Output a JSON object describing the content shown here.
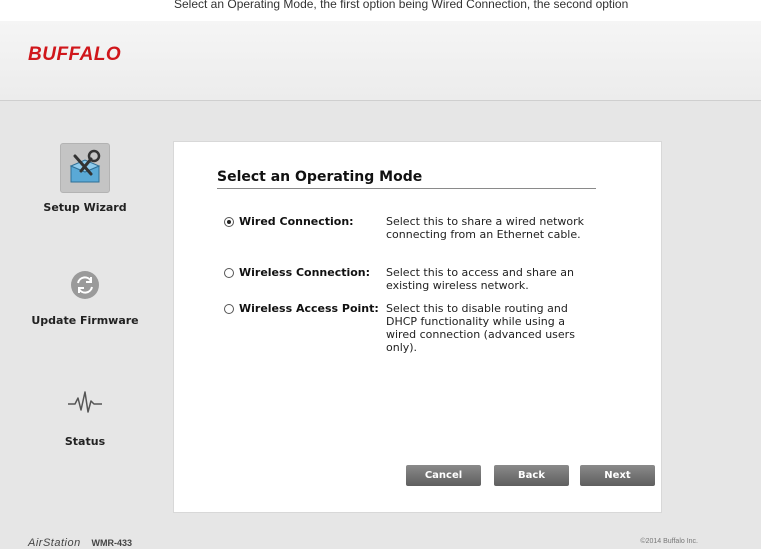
{
  "caption": "Select an Operating Mode, the first option being Wired Connection, the second option",
  "header": {
    "brand": "BUFFALO"
  },
  "sidebar": {
    "items": [
      {
        "label": "Setup Wizard",
        "icon": "wrench-toolbox-icon"
      },
      {
        "label": "Update Firmware",
        "icon": "refresh-icon"
      },
      {
        "label": "Status",
        "icon": "pulse-icon"
      }
    ]
  },
  "panel": {
    "title": "Select an Operating Mode",
    "options": [
      {
        "label": "Wired Connection:",
        "description": "Select this to share a wired network connecting from an Ethernet cable.",
        "selected": true
      },
      {
        "label": "Wireless Connection:",
        "description": "Select this to access and share an existing wireless network.",
        "selected": false
      },
      {
        "label": "Wireless Access Point:",
        "description": "Select this to disable routing and DHCP functionality while using a wired connection (advanced users only).",
        "selected": false
      }
    ],
    "buttons": {
      "cancel": "Cancel",
      "back": "Back",
      "next": "Next"
    }
  },
  "footer": {
    "product": "AirStation",
    "model": "WMR-433",
    "copyright": "©2014 Buffalo Inc."
  },
  "colors": {
    "brand": "#d0161b",
    "button": "#6f6f6f",
    "background": "#e6e6e6"
  }
}
